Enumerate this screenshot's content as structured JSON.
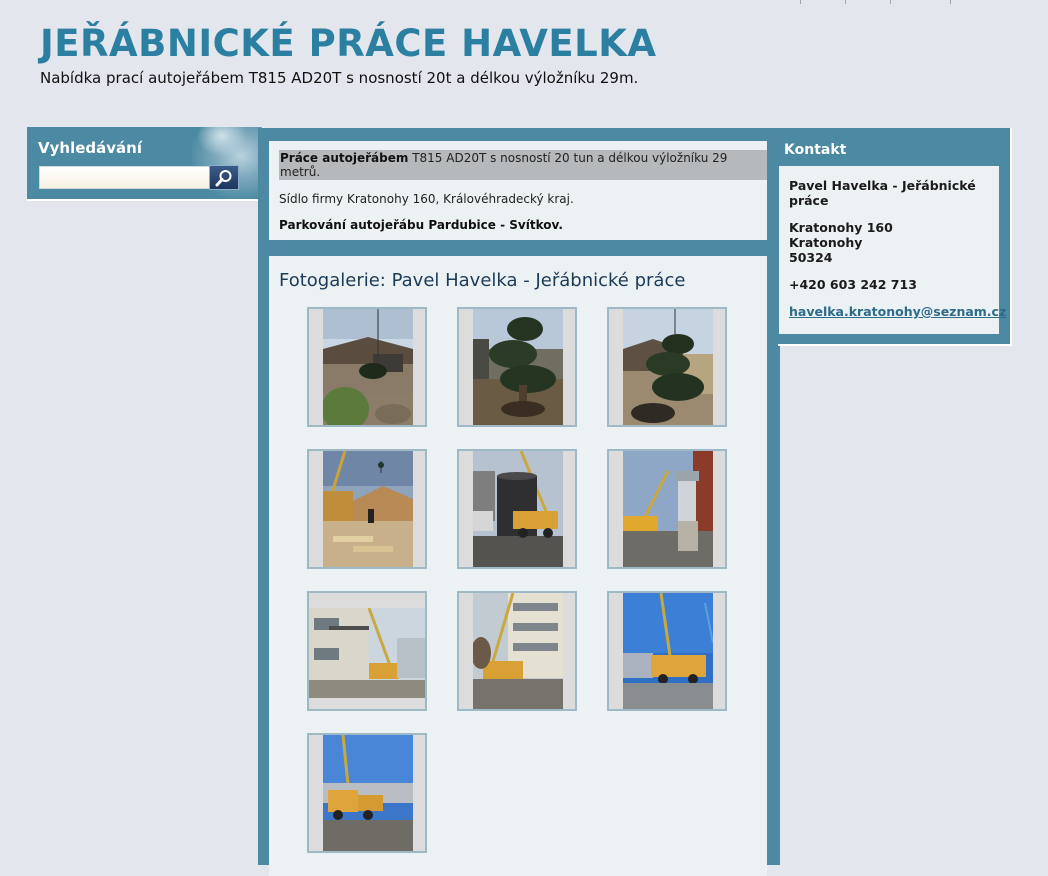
{
  "header": {
    "title": "JEŘÁBNICKÉ PRÁCE HAVELKA",
    "subtitle": "Nabídka prací autojeřábem T815 AD20T s nosností 20t a délkou výložníku 29m."
  },
  "search": {
    "title": "Vyhledávání",
    "value": "",
    "placeholder": ""
  },
  "intro": {
    "line1_bold": "Práce autojeřábem",
    "line1_rest": " T815 AD20T s nosností 20 tun a délkou výložníku 29 metrů.",
    "line2": "Sídlo firmy Kratonohy 160, Královéhradecký kraj.",
    "line3": "Parkování autojeřábu Pardubice - Svítkov."
  },
  "gallery": {
    "title": "Fotogalerie: Pavel Havelka - Jeřábnické práce",
    "photos": [
      {
        "subject": "bonsai-tree-lift-house",
        "orientation": "portrait"
      },
      {
        "subject": "bonsai-tree-closeup",
        "orientation": "portrait"
      },
      {
        "subject": "bonsai-tree-garden",
        "orientation": "portrait"
      },
      {
        "subject": "crane-timber-roof",
        "orientation": "portrait"
      },
      {
        "subject": "crane-silo-tank",
        "orientation": "portrait"
      },
      {
        "subject": "crane-industrial-tower",
        "orientation": "portrait"
      },
      {
        "subject": "crane-building-balcony",
        "orientation": "landscape"
      },
      {
        "subject": "crane-building-facade",
        "orientation": "portrait"
      },
      {
        "subject": "crane-truck-blue-sky",
        "orientation": "portrait"
      },
      {
        "subject": "crane-truck-yard",
        "orientation": "portrait"
      }
    ]
  },
  "contact": {
    "title": "Kontakt",
    "name": "Pavel Havelka - Jeřábnické práce",
    "street": "Kratonohy 160",
    "city": "Kratonohy",
    "zip": "50324",
    "phone": "+420 603 242 713",
    "email": "havelka.kratonohy@seznam.cz"
  },
  "colors": {
    "page_bg": "#e3e6ed",
    "panel_frame": "#4b8aa2",
    "panel_bg": "#ecf1f4",
    "title": "#2b7fa0"
  }
}
